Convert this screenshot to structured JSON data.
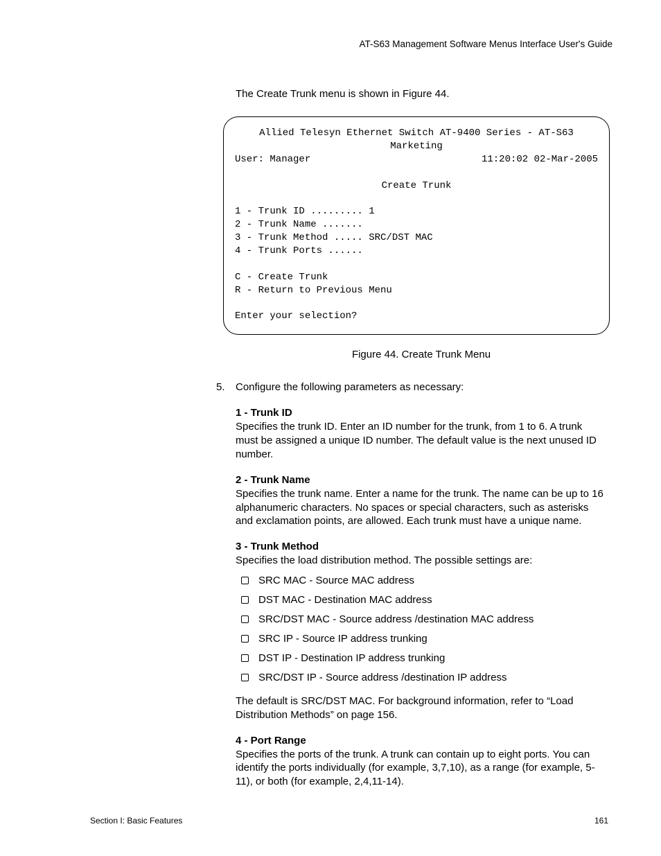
{
  "header": {
    "guide_title": "AT-S63 Management Software Menus Interface User's Guide"
  },
  "intro": "The Create Trunk menu is shown in Figure 44.",
  "terminal": {
    "title_line": "Allied Telesyn Ethernet Switch AT-9400 Series - AT-S63",
    "subtitle": "Marketing",
    "user_label": "User: Manager",
    "timestamp": "11:20:02 02-Mar-2005",
    "menu_title": "Create Trunk",
    "items": [
      "1 - Trunk ID ......... 1",
      "2 - Trunk Name .......",
      "3 - Trunk Method ..... SRC/DST MAC",
      "4 - Trunk Ports ......"
    ],
    "actions": [
      "C - Create Trunk",
      "R - Return to Previous Menu"
    ],
    "prompt": "Enter your selection?"
  },
  "figure_caption": "Figure 44. Create Trunk Menu",
  "step": {
    "number": "5.",
    "text": "Configure the following parameters as necessary:"
  },
  "params": {
    "p1": {
      "title": "1 - Trunk ID",
      "body": "Specifies the trunk ID. Enter an ID number for the trunk, from 1 to 6. A trunk must be assigned a unique ID number. The default value is the next unused ID number."
    },
    "p2": {
      "title": "2 - Trunk Name",
      "body": "Specifies the trunk name. Enter a name for the trunk. The name can be up to 16 alphanumeric characters. No spaces or special characters, such as asterisks and exclamation points, are allowed. Each trunk must have a unique name."
    },
    "p3": {
      "title": "3 - Trunk Method",
      "body": "Specifies the load distribution method. The possible settings are:",
      "bullets": [
        "SRC MAC - Source MAC address",
        "DST MAC - Destination MAC address",
        "SRC/DST MAC - Source address /destination MAC address",
        "SRC IP - Source IP address trunking",
        "DST IP - Destination IP address trunking",
        "SRC/DST IP - Source address /destination IP address"
      ],
      "tail": "The default is SRC/DST MAC. For background information, refer to “Load Distribution Methods” on page 156."
    },
    "p4": {
      "title": "4 - Port Range",
      "body": "Specifies the ports of the trunk. A trunk can contain up to eight ports. You can identify the ports individually (for example, 3,7,10), as a range (for example, 5-11), or both (for example, 2,4,11-14)."
    }
  },
  "footer": {
    "section": "Section I: Basic Features",
    "page": "161"
  }
}
